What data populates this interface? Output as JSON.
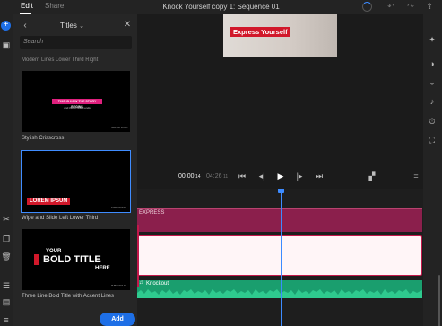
{
  "topbar": {
    "tab_edit": "Edit",
    "tab_share": "Share",
    "project_title": "Knock Yourself copy 1: Sequence 01"
  },
  "panel": {
    "dropdown_label": "Titles",
    "search_placeholder": "Search",
    "partial_caption": "Modern Lines Lower Third Right",
    "templates": [
      {
        "name": "Stylish Crisscross",
        "thumb_text": "THIS IS HOW THE STORY BEGINS",
        "thumb_subtext": "and this is how it ends",
        "thumb_corner": "VIDEOELECOM"
      },
      {
        "name": "Wipe and Slide Left Lower Third",
        "thumb_text": "LOREM IPSUM",
        "thumb_corner": "PUBLICFOLIO"
      },
      {
        "name": "Three Line Bold Title with Accent Lines",
        "thumb_line1": "YOUR",
        "thumb_line2": "BOLD TITLE",
        "thumb_line3": "HERE",
        "thumb_corner": "PUBLICFOLIO"
      }
    ],
    "add_label": "Add"
  },
  "preview": {
    "title_text": "Express Yourself"
  },
  "transport": {
    "current_time": "00:00",
    "current_frames": "14",
    "duration_time": "04:26",
    "duration_frames": "11"
  },
  "timeline": {
    "title_clip_label": "EXPRESS",
    "audio_clip_label": "Knockout"
  },
  "colors": {
    "accent": "#1e6fe6",
    "title_track": "#8b1f4c",
    "audio_track": "#1a9e6e",
    "playhead": "#3d8bff",
    "preview_title_bg": "#d1182a"
  }
}
